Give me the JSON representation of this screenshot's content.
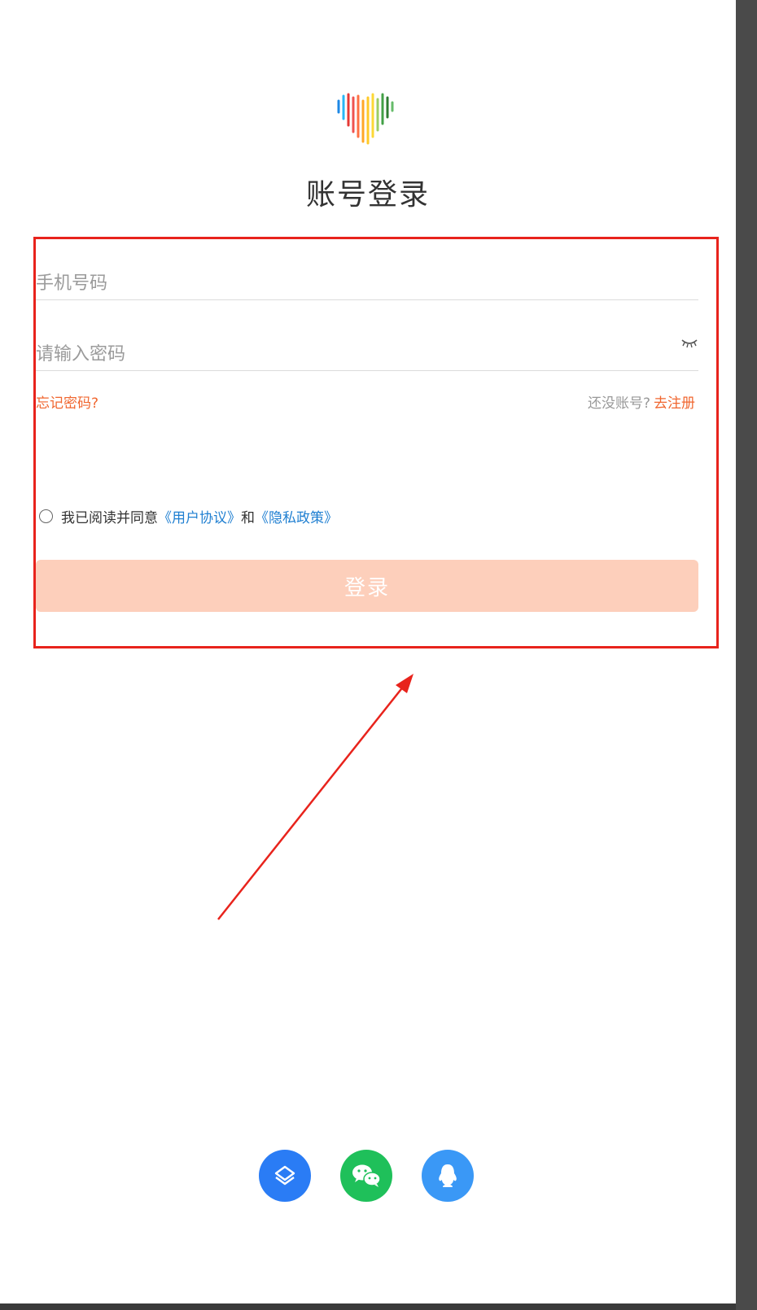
{
  "page": {
    "title": "账号登录"
  },
  "form": {
    "phone_placeholder": "手机号码",
    "password_placeholder": "请输入密码",
    "forgot_label": "忘记密码?",
    "no_account_label": "还没账号?",
    "register_label": "去注册",
    "agree_prefix": "我已阅读并同意",
    "user_agreement": "《用户协议》",
    "and": "和",
    "privacy_policy": "《隐私政策》",
    "login_label": "登录"
  },
  "icons": {
    "logo": "heartbeat-logo-icon",
    "eye": "eye-closed-icon",
    "china_mobile": "china-mobile-icon",
    "wechat": "wechat-icon",
    "qq": "qq-icon"
  },
  "colors": {
    "accent": "#f0662f",
    "login_button_disabled": "#fdcfbb",
    "link": "#1f7fd1",
    "annotation": "#e8231c",
    "china_mobile": "#2a7cf5",
    "wechat": "#1fc05a",
    "qq": "#3a98f6"
  }
}
